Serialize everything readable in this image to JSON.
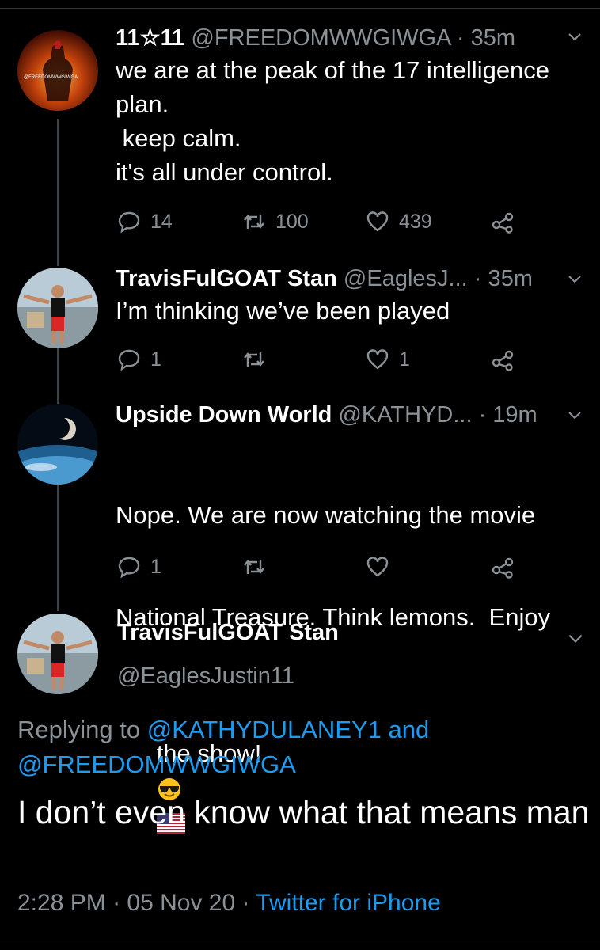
{
  "thread": [
    {
      "display_name": "11☆11",
      "handle": "@FREEDOMWWGIWGA",
      "time": "· 35m",
      "text": "we are at the peak of the 17 intelligence\nplan.\n keep calm.\nit's all under control.",
      "avatar_watermark": "@FREEDOMWWGIWGA",
      "replies": "14",
      "retweets": "100",
      "likes": "439"
    },
    {
      "display_name": "TravisFulGOAT Stan",
      "handle": "@EaglesJ...",
      "time": "· 35m",
      "text": "I’m thinking we’ve been played",
      "replies": "1",
      "retweets": "",
      "likes": "1"
    },
    {
      "display_name": "Upside Down World",
      "handle": "@KATHYD...",
      "time": "· 19m",
      "text_line1": "Nope. We are now watching the movie",
      "text_line2": "National Treasure. Think lemons.  Enjoy",
      "text_line3": "the show!",
      "emojis": [
        "sunglasses-emoji",
        "us-flag-emoji"
      ],
      "replies": "1",
      "retweets": "",
      "likes": ""
    }
  ],
  "main_tweet": {
    "display_name": "TravisFulGOAT Stan",
    "handle": "@EaglesJustin11",
    "replying_prefix": "Replying to",
    "replying_user1": "@KATHYDULANEY1",
    "replying_and": "and",
    "replying_user2": "@FREEDOMWWGIWGA",
    "text": "I don’t even know what that means man",
    "time": "2:28 PM",
    "date": "05 Nov 20",
    "source": "Twitter for iPhone"
  },
  "colors": {
    "background": "#000000",
    "secondary_text": "#8a9197",
    "link": "#1d9bf0"
  }
}
